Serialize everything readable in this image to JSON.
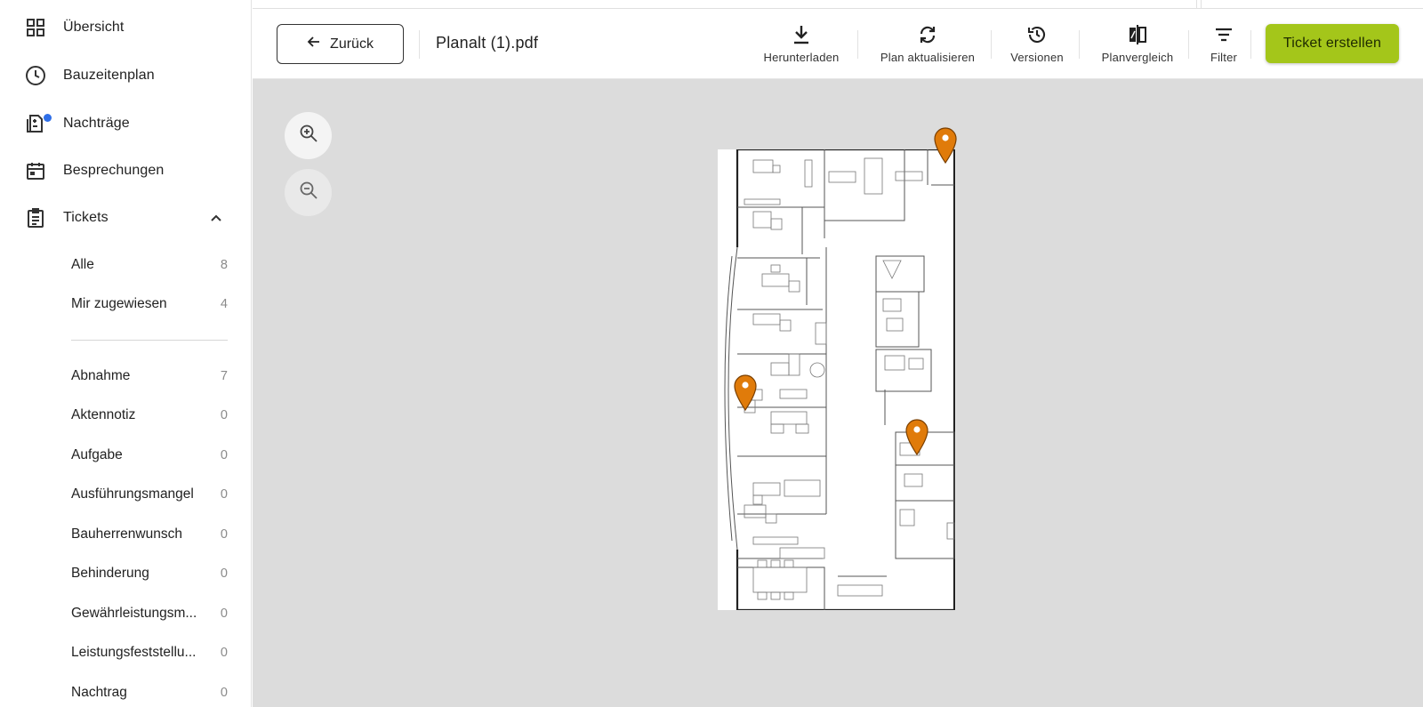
{
  "sidebar": {
    "nav": [
      {
        "label": "Übersicht",
        "icon": "dashboard-grid-icon"
      },
      {
        "label": "Bauzeitenplan",
        "icon": "clock-icon"
      },
      {
        "label": "Nachträge",
        "icon": "document-plus-minus-icon",
        "has_notification": true
      },
      {
        "label": "Besprechungen",
        "icon": "calendar-icon"
      },
      {
        "label": "Tickets",
        "icon": "clipboard-list-icon",
        "expanded": true
      }
    ],
    "ticket_filters": [
      {
        "label": "Alle",
        "count": "8"
      },
      {
        "label": "Mir zugewiesen",
        "count": "4"
      }
    ],
    "ticket_types": [
      {
        "label": "Abnahme",
        "count": "7"
      },
      {
        "label": "Aktennotiz",
        "count": "0"
      },
      {
        "label": "Aufgabe",
        "count": "0"
      },
      {
        "label": "Ausführungsmangel",
        "count": "0"
      },
      {
        "label": "Bauherrenwunsch",
        "count": "0"
      },
      {
        "label": "Behinderung",
        "count": "0"
      },
      {
        "label": "Gewährleistungsm...",
        "count": "0"
      },
      {
        "label": "Leistungsfeststellu...",
        "count": "0"
      },
      {
        "label": "Nachtrag",
        "count": "0"
      }
    ]
  },
  "toolbar": {
    "back_label": "Zurück",
    "document_title": "Planalt (1).pdf",
    "tools": [
      {
        "label": "Herunterladen",
        "icon": "download-icon"
      },
      {
        "label": "Plan aktualisieren",
        "icon": "refresh-icon"
      },
      {
        "label": "Versionen",
        "icon": "history-icon"
      },
      {
        "label": "Planvergleich",
        "icon": "compare-icon"
      },
      {
        "label": "Filter",
        "icon": "filter-icon"
      }
    ],
    "primary_action": "Ticket erstellen"
  },
  "viewer": {
    "zoom_in_icon": "zoom-in-icon",
    "zoom_out_icon": "zoom-out-icon",
    "pin_color": "#e07b0a",
    "pins": 3
  },
  "colors": {
    "accent": "#a4c61a",
    "notification": "#2f6fe8",
    "pin": "#e07b0a",
    "viewer_bg": "#dcdcdc"
  }
}
